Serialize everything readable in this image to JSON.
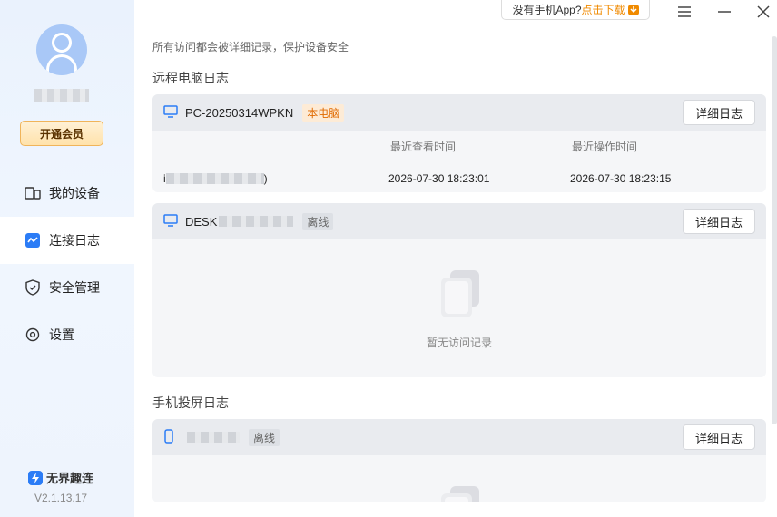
{
  "sidebar": {
    "vip_label": "开通会员",
    "items": [
      {
        "label": "我的设备",
        "icon": "devices-icon"
      },
      {
        "label": "连接日志",
        "icon": "log-icon"
      },
      {
        "label": "安全管理",
        "icon": "shield-icon"
      },
      {
        "label": "设置",
        "icon": "settings-icon"
      }
    ],
    "active_item": "连接日志",
    "brand": "无界趣连",
    "version": "V2.1.13.17"
  },
  "topbar": {
    "promo_text": "没有手机App?",
    "promo_link": "点击下载"
  },
  "main": {
    "notice": "所有访问都会被详细记录，保护设备安全",
    "remote_section_title": "远程电脑日志",
    "mobile_section_title": "手机投屏日志",
    "detail_label": "详细日志",
    "devices": [
      {
        "name": "PC-20250314WPKN",
        "tag": "本电脑",
        "columns": [
          "最近查看时间",
          "最近操作时间"
        ],
        "row": {
          "ip_prefix": "i",
          "ip_suffix": ")",
          "view_time": "2026-07-30 18:23:01",
          "op_time": "2026-07-30 18:23:15"
        }
      },
      {
        "name": "DESK",
        "tag": "离线",
        "empty_text": "暂无访问记录"
      }
    ],
    "mobile_devices": [
      {
        "tag": "离线"
      }
    ]
  },
  "colors": {
    "accent": "#2b7cf6",
    "local_tag": "#e06a00",
    "promo": "#f08a00"
  }
}
